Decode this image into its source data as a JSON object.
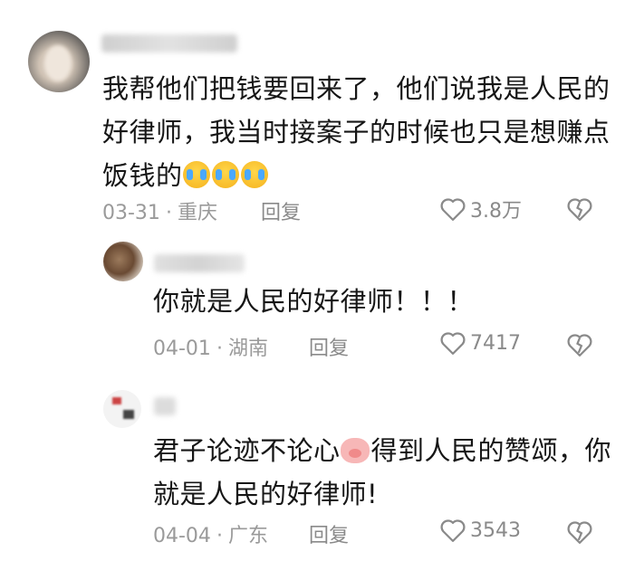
{
  "comments": [
    {
      "text_lines": [
        "我帮他们把钱要回来了，他们说我是人民的",
        "好律师，我当时接案子的时候也只是想赚点",
        "饭钱的"
      ],
      "date": "03-31",
      "location": "重庆",
      "reply_label": "回复",
      "likes": "3.8万",
      "emoji": "crying-face-emoji"
    },
    {
      "text_lines": [
        "你就是人民的好律师！！！"
      ],
      "date": "04-01",
      "location": "湖南",
      "reply_label": "回复",
      "likes": "7417"
    },
    {
      "text_lines": [
        "君子论迹不论心",
        "得到人民的赞颂，你",
        "就是人民的好律师!"
      ],
      "date": "04-04",
      "location": "广东",
      "reply_label": "回复",
      "likes": "3543",
      "emoji": "pig-face-emoji"
    }
  ],
  "colors": {
    "text": "#161616",
    "meta": "#9a9a9a",
    "icon": "#8a8a8a"
  }
}
